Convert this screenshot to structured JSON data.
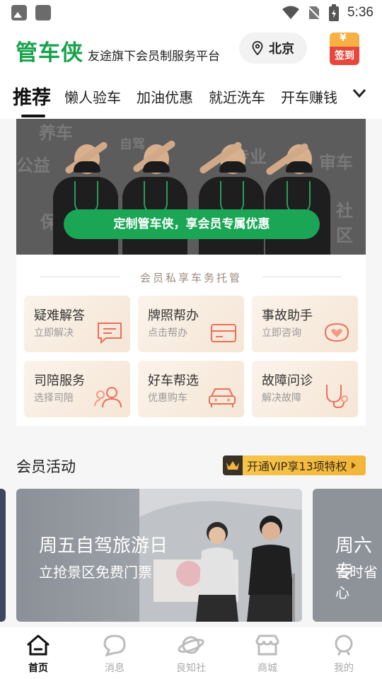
{
  "status_bar": {
    "time": "5:36"
  },
  "header": {
    "logo": "管车侠",
    "tagline": "友途旗下会员制服务平台",
    "city": "北京",
    "checkin_label": "签到"
  },
  "tabs": [
    {
      "label": "推荐",
      "active": true
    },
    {
      "label": "懒人验车"
    },
    {
      "label": "加油优惠"
    },
    {
      "label": "就近洗车"
    },
    {
      "label": "开车赚钱"
    }
  ],
  "banner": {
    "button_label": "定制管车侠，享会员专属优惠",
    "bg_words": [
      "养车",
      "公益",
      "自驾",
      "专业",
      "审车",
      "保险",
      "社区"
    ]
  },
  "services": {
    "section_title": "会员私享车务托管",
    "items": [
      {
        "title": "疑难解答",
        "subtitle": "立即解决",
        "icon": "chat-icon"
      },
      {
        "title": "牌照帮办",
        "subtitle": "点击帮办",
        "icon": "card-icon"
      },
      {
        "title": "事故助手",
        "subtitle": "立即咨询",
        "icon": "heart-icon"
      },
      {
        "title": "司陪服务",
        "subtitle": "选择司陪",
        "icon": "people-icon"
      },
      {
        "title": "好车帮选",
        "subtitle": "优惠购车",
        "icon": "car-icon"
      },
      {
        "title": "故障问诊",
        "subtitle": "解决故障",
        "icon": "stethoscope-icon"
      }
    ]
  },
  "activity": {
    "title": "会员活动",
    "vip_label": "开通VIP享13项特权",
    "cards": [
      {
        "title": "周五自驾旅游日",
        "subtitle": "立抢景区免费门票"
      },
      {
        "title": "周六专",
        "subtitle": "省时省心"
      }
    ]
  },
  "bottom_nav": [
    {
      "label": "首页",
      "icon": "home-icon",
      "active": true
    },
    {
      "label": "消息",
      "icon": "message-icon"
    },
    {
      "label": "良知社",
      "icon": "planet-icon"
    },
    {
      "label": "商城",
      "icon": "store-icon"
    },
    {
      "label": "我的",
      "icon": "profile-icon"
    }
  ],
  "colors": {
    "brand_green": "#17a34a",
    "button_green": "#1aa655",
    "vip_gold": "#f2b53a"
  }
}
